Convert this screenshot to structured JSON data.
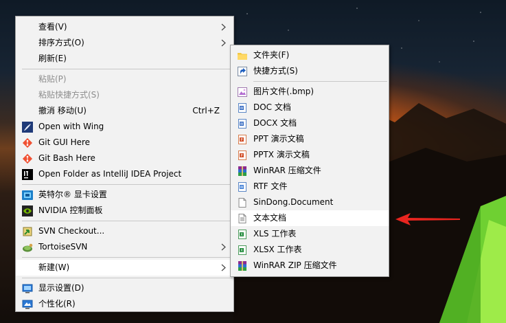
{
  "context_menu": {
    "items": [
      {
        "label": "查看(V)"
      },
      {
        "label": "排序方式(O)"
      },
      {
        "label": "刷新(E)"
      },
      {
        "label": "粘贴(P)"
      },
      {
        "label": "粘贴快捷方式(S)"
      },
      {
        "label": "撤消 移动(U)",
        "shortcut": "Ctrl+Z"
      },
      {
        "label": "Open with Wing"
      },
      {
        "label": "Git GUI Here"
      },
      {
        "label": "Git Bash Here"
      },
      {
        "label": "Open Folder as IntelliJ IDEA Project"
      },
      {
        "label": "英特尔® 显卡设置"
      },
      {
        "label": "NVIDIA 控制面板"
      },
      {
        "label": "SVN Checkout..."
      },
      {
        "label": "TortoiseSVN"
      },
      {
        "label": "新建(W)"
      },
      {
        "label": "显示设置(D)"
      },
      {
        "label": "个性化(R)"
      }
    ]
  },
  "new_submenu": {
    "items": [
      {
        "label": "文件夹(F)",
        "icon": "folder-icon"
      },
      {
        "label": "快捷方式(S)",
        "icon": "shortcut-icon"
      },
      {
        "label": "图片文件(.bmp)",
        "icon": "bitmap-image-icon"
      },
      {
        "label": "DOC 文档",
        "icon": "word-doc-icon"
      },
      {
        "label": "DOCX 文档",
        "icon": "word-docx-icon"
      },
      {
        "label": "PPT 演示文稿",
        "icon": "powerpoint-ppt-icon"
      },
      {
        "label": "PPTX 演示文稿",
        "icon": "powerpoint-pptx-icon"
      },
      {
        "label": "WinRAR 压缩文件",
        "icon": "winrar-archive-icon"
      },
      {
        "label": "RTF 文件",
        "icon": "rtf-document-icon"
      },
      {
        "label": "SinDong.Document",
        "icon": "blank-document-icon"
      },
      {
        "label": "文本文档",
        "icon": "text-document-icon"
      },
      {
        "label": "XLS 工作表",
        "icon": "excel-xls-icon"
      },
      {
        "label": "XLSX 工作表",
        "icon": "excel-xlsx-icon"
      },
      {
        "label": "WinRAR ZIP 压缩文件",
        "icon": "winrar-zip-icon"
      }
    ]
  },
  "colors": {
    "menu_background": "#f2f2f2",
    "highlight": "#ffffff",
    "disabled_text": "#8d8d8d",
    "annotation_arrow": "#e8251f"
  }
}
